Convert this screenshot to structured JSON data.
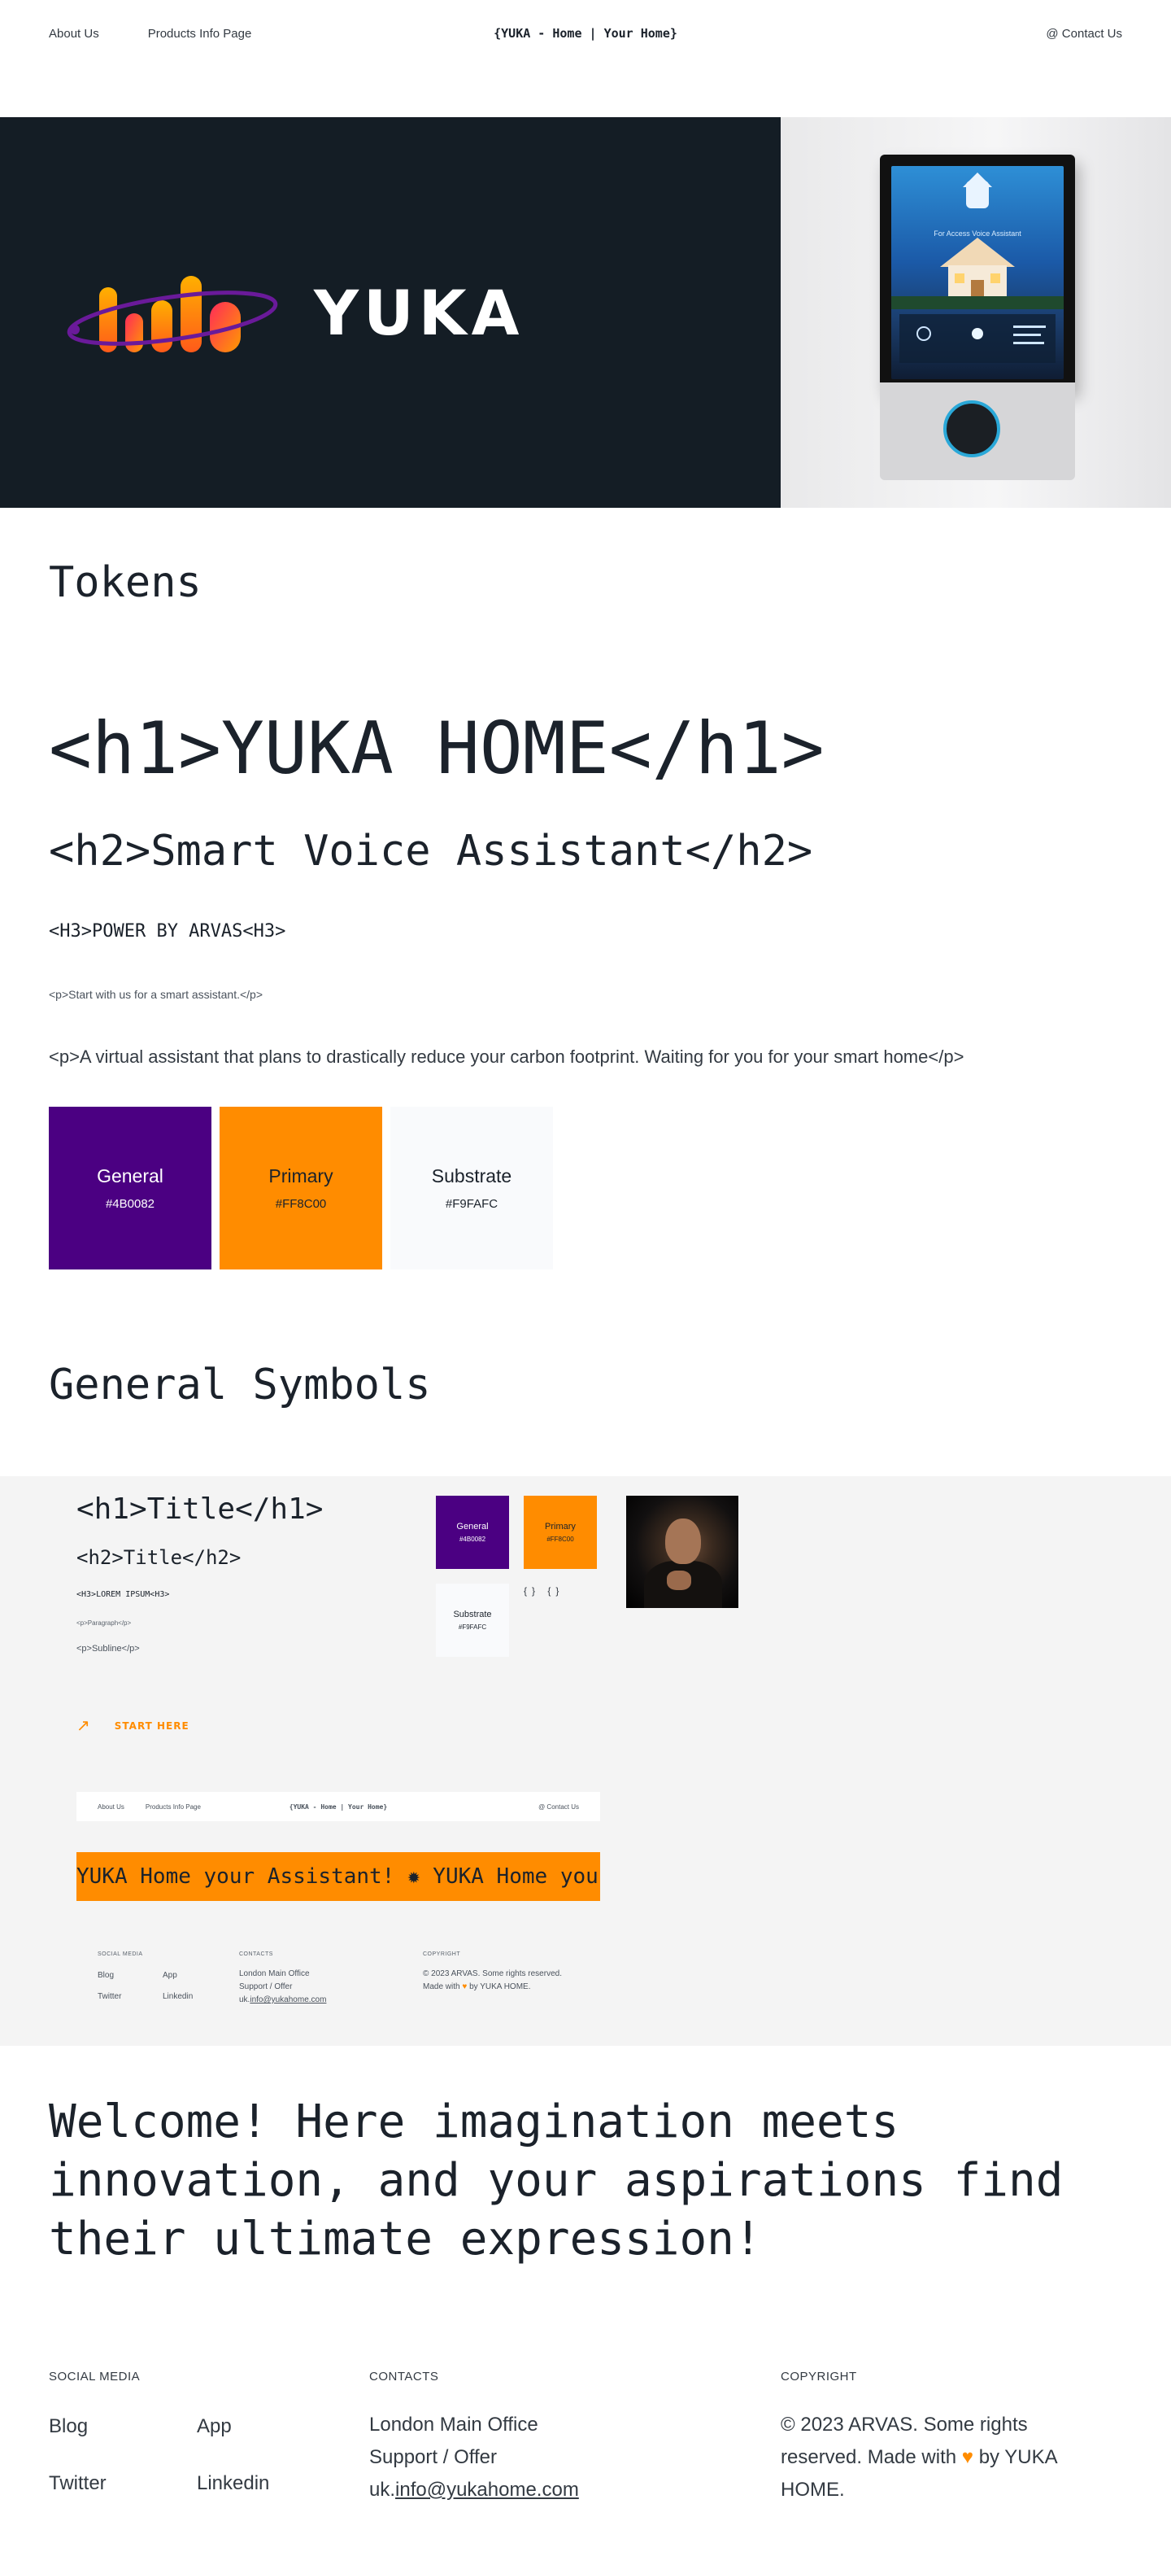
{
  "nav": {
    "about": "About Us",
    "products": "Products Info Page",
    "brand": "{YUKA - Home | Your Home}",
    "contact": "@ Contact Us"
  },
  "hero": {
    "logo_word": "YUKA",
    "device_caption": "For Access Voice Assistant"
  },
  "tokens": {
    "heading": "Tokens",
    "h1_sample": "<h1>YUKA HOME</h1>",
    "h2_sample": "<h2>Smart Voice Assistant</h2>",
    "h3_sample": "<H3>POWER BY ARVAS<H3>",
    "p_small": "<p>Start with us for a smart assistant.</p>",
    "p_large": "<p>A virtual assistant that plans to drastically reduce your carbon footprint. Waiting for you for your smart home</p>",
    "swatches": [
      {
        "name": "General",
        "hex": "#4B0082",
        "color": "#4B0082",
        "text_color": "#ffffff"
      },
      {
        "name": "Primary",
        "hex": "#FF8C00",
        "color": "#FF8C00",
        "text_color": "#1b222b"
      },
      {
        "name": "Substrate",
        "hex": "#F9FAFC",
        "color": "#F9FAFC",
        "text_color": "#1b222b"
      }
    ]
  },
  "symbols": {
    "heading": "General Symbols",
    "h1": "<h1>Title</h1>",
    "h2": "<h2>Title</h2>",
    "h3": "<H3>LOREM IPSUM<H3>",
    "p_paragraph": "<p>Paragraph</p>",
    "p_subline": "<p>Subline</p>",
    "cta": "START HERE",
    "mini_swatches": [
      {
        "name": "General",
        "hex": "#4B0082"
      },
      {
        "name": "Primary",
        "hex": "#FF8C00"
      },
      {
        "name": "Substrate",
        "hex": "#F9FAFC"
      }
    ],
    "mini_icons": "{} {}",
    "mini_nav": {
      "about": "About Us",
      "products": "Products Info Page",
      "brand": "{YUKA - Home | Your Home}",
      "contact": "@ Contact Us"
    },
    "marquee": "YUKA Home your Assistant! ✹ YUKA Home your Assistant!",
    "mini_footer": {
      "social_heading": "SOCIAL MEDIA",
      "contacts_heading": "CONTACTS",
      "copyright_heading": "COPYRIGHT",
      "blog": "Blog",
      "app": "App",
      "twitter": "Twitter",
      "linkedin": "Linkedin",
      "contacts_line1": "London Main Office",
      "contacts_line2": "Support / Offer",
      "contacts_prefix": "uk.",
      "contacts_email": "info@yukahome.com",
      "copyright_text_a": "© 2023 ARVAS. Some rights reserved. Made with",
      "copyright_text_b": "by YUKA HOME."
    }
  },
  "welcome": "Welcome! Here imagination meets innovation, and your aspirations find their ultimate expression!",
  "footer": {
    "social_heading": "SOCIAL MEDIA",
    "contacts_heading": "CONTACTS",
    "copyright_heading": "COPYRIGHT",
    "blog": "Blog",
    "app": "App",
    "twitter": "Twitter",
    "linkedin": "Linkedin",
    "contacts_line1": "London Main Office",
    "contacts_line2": "Support / Offer",
    "contacts_prefix": "uk.",
    "contacts_email": "info@yukahome.com",
    "copyright_text_a": "© 2023 ARVAS. Some rights reserved. Made with",
    "heart": "♥",
    "copyright_text_b": "by YUKA HOME."
  },
  "colors": {
    "general": "#4B0082",
    "primary": "#FF8C00",
    "substrate": "#F9FAFC",
    "dark": "#141D25",
    "panel": "#F4F4F4"
  }
}
